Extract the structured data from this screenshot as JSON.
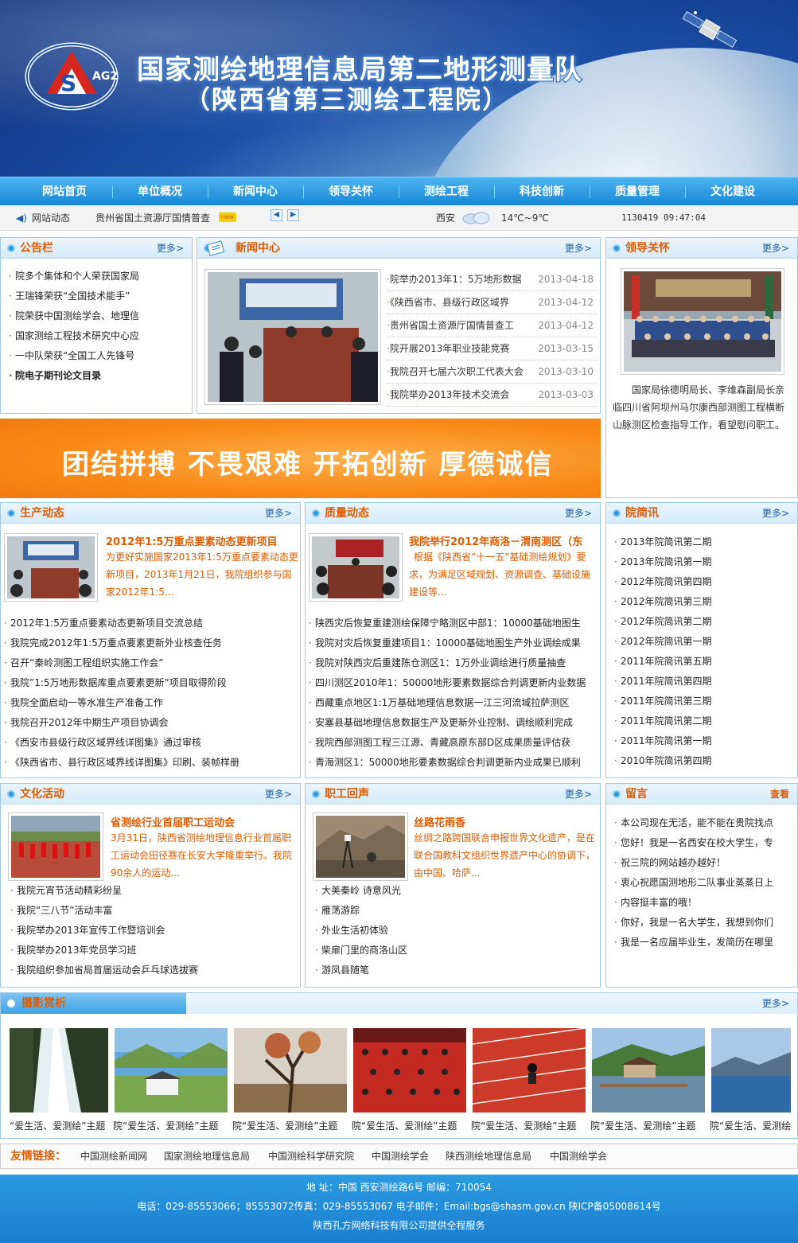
{
  "header": {
    "title_main": "国家测绘地理信息局第二地形测量队",
    "title_sub": "（陕西省第三测绘工程院）",
    "logo_text": "AG2"
  },
  "nav": {
    "items": [
      "网站首页",
      "单位概况",
      "新闻中心",
      "领导关怀",
      "测绘工程",
      "科技创新",
      "质量管理",
      "文化建设"
    ]
  },
  "ticker": {
    "label": "网站动态",
    "headline": "贵州省国土资源厅国情普查",
    "city": "西安",
    "temp": "14℃~9℃",
    "datetime": "1130419 09:47:04"
  },
  "notice": {
    "title": "公告栏",
    "more": "更多",
    "items": [
      "院多个集体和个人荣获国家局",
      "王瑞锋荣获“全国技术能手”",
      "院荣获中国测绘学会、地理信",
      "国家测绘工程技术研究中心应",
      "一中队荣获“全国工人先锋号",
      "院电子期刊论文目录"
    ]
  },
  "news": {
    "title": "新闻中心",
    "more": "更多",
    "items": [
      {
        "text": "院举办2013年1：5万地形数据",
        "date": "2013-04-18"
      },
      {
        "text": "《陕西省市、县级行政区域界",
        "date": "2013-04-12"
      },
      {
        "text": "贵州省国土资源厅国情普查工",
        "date": "2013-04-12"
      },
      {
        "text": "院开展2013年职业技能竞赛",
        "date": "2013-03-15"
      },
      {
        "text": "我院召开七届六次职工代表大会",
        "date": "2013-03-10"
      },
      {
        "text": "我院举办2013年技术交流会",
        "date": "2013-03-03"
      }
    ]
  },
  "leader": {
    "title": "领导关怀",
    "more": "更多",
    "desc": "国家局徐德明局长、李维森副局长亲临四川省阿坝州马尔康西部测图工程横断山脉测区检查指导工作，看望慰问职工。"
  },
  "slogan": {
    "text": "团结拼搏  不畏艰难  开拓创新  厚德诚信"
  },
  "production": {
    "title": "生产动态",
    "more": "更多",
    "feature_title": "2012年1:5万重点要素动态更新项目",
    "feature_desc": "为更好实施国家2013年1:5万重点要素动态更新项目，2013年1月21日，我院组织参与国家2012年1:5...",
    "items": [
      "2012年1:5万重点要素动态更新项目交流总结",
      "我院完成2012年1:5万重点要素更新外业核查任务",
      "召开“秦岭测图工程组织实施工作会”",
      "我院”1:5万地形数据库重点要素更新”项目取得阶段",
      "我院全面启动一等水准生产准备工作",
      "我院召开2012年中期生产项目协调会",
      "《西安市县级行政区域界线详图集》通过审核",
      "《陕西省市、县行政区域界线详图集》印刷、装帧样册"
    ]
  },
  "quality": {
    "title": "质量动态",
    "more": "更多",
    "feature_title": "我院举行2012年商洛－渭南测区（东",
    "feature_desc": "根据《陕西省“十一五”基础测绘规划》要求，为满足区域规划、资源调查、基础设施建设等...",
    "items": [
      "陕西灾后恢复重建测绘保障宁略测区中部1：10000基础地图生",
      "我院对灾后恢复重建项目1：10000基础地图生产外业调绘成果",
      "我院对陕西灾后重建陈仓测区1：1万外业调绘进行质量抽查",
      "四川测区2010年1：50000地形要素数据综合判调更新内业数据",
      "西藏重点地区1:1万基础地理信息数据一江三河流域拉萨测区",
      "安塞县基础地理信息数据生产及更新外业控制、调绘顺利完成",
      "我院西部测图工程三江源、青藏高原东部D区成果质量评估获",
      "青海测区1：50000地形要素数据综合判调更新内业成果已顺利"
    ]
  },
  "bulletin": {
    "title": "院简讯",
    "more": "更多",
    "items": [
      "2013年院简讯第二期",
      "2013年院简讯第一期",
      "2012年院简讯第四期",
      "2012年院简讯第三期",
      "2012年院简讯第二期",
      "2012年院简讯第一期",
      "2011年院简讯第五期",
      "2011年院简讯第四期",
      "2011年院简讯第三期",
      "2011年院简讯第二期",
      "2011年院简讯第一期",
      "2010年院简讯第四期"
    ]
  },
  "culture": {
    "title": "文化活动",
    "more": "更多",
    "feature_title": "省测绘行业首届职工运动会",
    "feature_desc": "3月31日，陕西省测绘地理信息行业首届职工运动会田径赛在长安大学隆重举行。我院90余人的运动...",
    "items": [
      "我院元宵节活动精彩纷呈",
      "我院“三八节”活动丰富",
      "我院举办2013年宣传工作暨培训会",
      "我院举办2013年党员学习班",
      "我院组织参加省局首届运动会乒乓球选拔赛"
    ]
  },
  "staff": {
    "title": "职工回声",
    "more": "更多",
    "feature_title": "丝路花雨香",
    "feature_desc": "丝绸之路跨国联合申报世界文化遗产，是在联合国教科文组织世界遗产中心的协调下，由中国、哈萨...",
    "items": [
      "大美秦岭 诗意风光",
      "雁荡游踪",
      "外业生活初体验",
      "柴扉门里的商洛山区",
      "游凤县随笔"
    ]
  },
  "message": {
    "title": "留言",
    "more": "查看",
    "items": [
      "本公司现在无活，能不能在贵院找点",
      "您好！我是一名西安在校大学生，专",
      "祝三院的网站越办越好！",
      "衷心祝愿国测地形二队事业蒸蒸日上",
      "内容挺丰富的哦！",
      "你好，我是一名大学生，我想到你们",
      "我是一名应届毕业生，发简历在哪里"
    ]
  },
  "gallery": {
    "title": "摄影赏析",
    "more": "更多",
    "captions": [
      "“爱生活、爱测绘”主题",
      "院“爱生活、爱测绘”主题",
      "院“爱生活、爱测绘”主题",
      "院“爱生活、爱测绘”主题",
      "院“爱生活、爱测绘”主题",
      "院“爱生活、爱测绘”主题",
      "院“爱生活、爱测绘"
    ]
  },
  "links": {
    "label": "友情链接：",
    "items": [
      "中国测绘新闻网",
      "国家测绘地理信息局",
      "中国测绘科学研究院",
      "中国测绘学会",
      "陕西测绘地理信息局",
      "中国测绘学会"
    ]
  },
  "footer": {
    "address": "地 址：中国 西安测绘路6号  邮编：710054",
    "contact": "电话：029-85553066；85553072传真：029-85553067 电子邮件：Email:bgs@shasm.gov.cn 陕ICP备05008614号",
    "credit": "陕西孔方网络科技有限公司提供全程服务"
  },
  "colors": {
    "accent": "#e05c00",
    "nav": "#1787d6",
    "link": "#1a5fa8"
  }
}
